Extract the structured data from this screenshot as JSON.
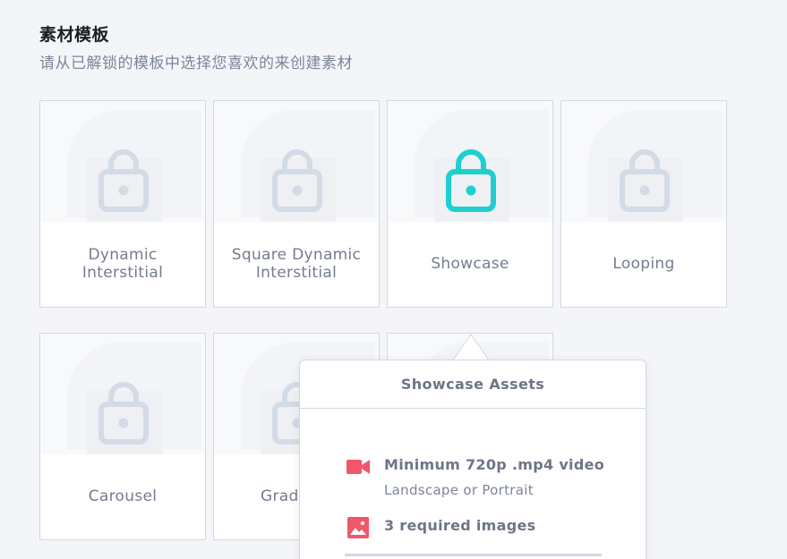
{
  "header": {
    "title": "素材模板",
    "subtitle": "请从已解锁的模板中选择您喜欢的来创建素材"
  },
  "templates": [
    {
      "label": "Dynamic Interstitial",
      "locked": true
    },
    {
      "label": "Square Dynamic Interstitial",
      "locked": true
    },
    {
      "label": "Showcase",
      "locked": false
    },
    {
      "label": "Looping",
      "locked": true
    },
    {
      "label": "Carousel",
      "locked": true
    },
    {
      "label": "Grad",
      "locked": true
    },
    {
      "label": "",
      "locked": true
    }
  ],
  "popover": {
    "title": "Showcase Assets",
    "assets": [
      {
        "icon": "video-camera-icon",
        "title": "Minimum 720p .mp4 video",
        "subtitle": "Landscape or Portrait"
      },
      {
        "icon": "image-icon",
        "title": "3 required images"
      }
    ]
  },
  "colors": {
    "background": "#f4f5f8",
    "lock_locked": "#d3dbe6",
    "lock_unlocked": "#1fcfcf",
    "asset_icon": "#f2566a",
    "text_muted": "#737c8f",
    "border": "#d2d8e4"
  }
}
